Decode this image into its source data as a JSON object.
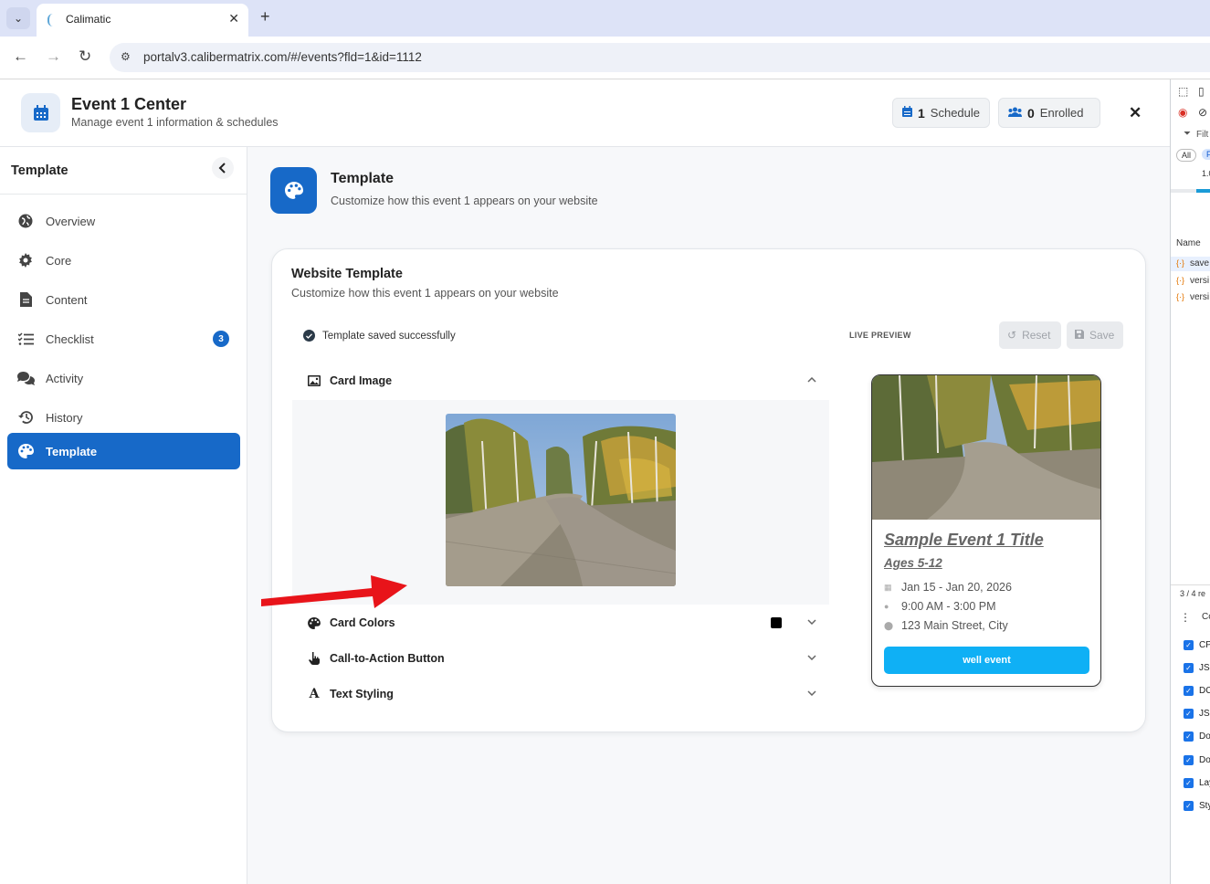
{
  "browser": {
    "tab_title": "Calimatic",
    "url": "portalv3.calibermatrix.com/#/events?fld=1&id=1112"
  },
  "header": {
    "title": "Event 1 Center",
    "subtitle": "Manage event 1 information & schedules",
    "schedule_count": "1",
    "schedule_label": "Schedule",
    "enrolled_count": "0",
    "enrolled_label": "Enrolled"
  },
  "sidebar": {
    "title": "Template",
    "items": [
      {
        "label": "Overview",
        "icon": "globe-icon"
      },
      {
        "label": "Core",
        "icon": "gear-icon"
      },
      {
        "label": "Content",
        "icon": "document-icon"
      },
      {
        "label": "Checklist",
        "icon": "checklist-icon",
        "badge": "3"
      },
      {
        "label": "Activity",
        "icon": "chat-icon"
      },
      {
        "label": "History",
        "icon": "history-icon"
      },
      {
        "label": "Template",
        "icon": "palette-icon",
        "active": true
      }
    ]
  },
  "main": {
    "title": "Template",
    "subtitle": "Customize how this event 1 appears on your website",
    "card": {
      "title": "Website Template",
      "subtitle": "Customize how this event 1 appears on your website",
      "saved_msg": "Template saved successfully",
      "live_preview": "LIVE PREVIEW",
      "reset_label": "Reset",
      "save_label": "Save",
      "sections": [
        "Card Image",
        "Card Colors",
        "Call-to-Action Button",
        "Text Styling"
      ]
    }
  },
  "preview": {
    "title": "Sample Event 1 Title",
    "ages": "Ages 5-12",
    "dates": "Jan 15 - Jan 20, 2026",
    "time": "9:00 AM - 3:00 PM",
    "location": "123 Main Street, City",
    "button": "well event",
    "button_color": "#0fb0f5"
  },
  "devtools": {
    "filter": "Filt",
    "all": "All",
    "value": "1.0",
    "name_header": "Name",
    "requests": [
      "save",
      "versi",
      "versi"
    ],
    "count": "3 / 4 re",
    "checks": [
      "CP",
      "JS",
      "DC",
      "JS",
      "Do",
      "Do",
      "Lay",
      "Sty"
    ]
  },
  "colors": {
    "accent": "#1769c8",
    "cta": "#0fb0f5",
    "annotation_arrow": "#e8141a"
  }
}
